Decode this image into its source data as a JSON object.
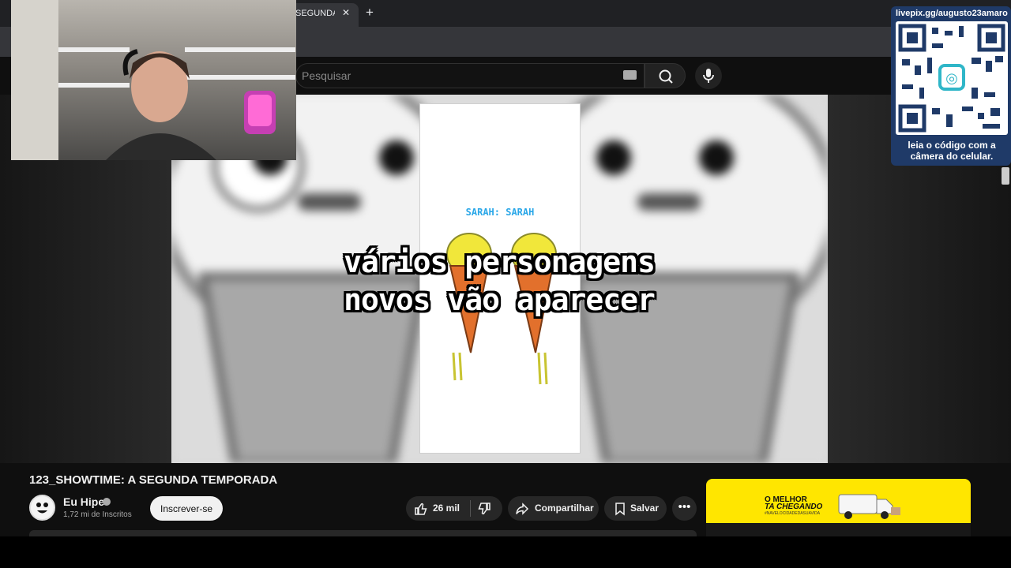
{
  "browser": {
    "tab_title": "SEGUNDA T",
    "tab_close": "✕",
    "new_tab": "+"
  },
  "search": {
    "placeholder": "Pesquisar"
  },
  "video": {
    "inner_caption": "SARAH: SARAH",
    "subtitle_line1": "vários personagens",
    "subtitle_line2": "novos vão aparecer",
    "title": "123_SHOWTIME: A SEGUNDA TEMPORADA"
  },
  "channel": {
    "name": "Eu Hipe",
    "subscribers": "1,72 mi de Inscritos",
    "subscribe_label": "Inscrever-se"
  },
  "actions": {
    "like_count": "26 mil",
    "share_label": "Compartilhar",
    "save_label": "Salvar",
    "more": "•••"
  },
  "qr": {
    "url": "livepix.gg/augusto23amaro",
    "caption": "leia o código com a câmera do celular."
  },
  "ad": {
    "line1": "O MELHOR",
    "line2": "TA CHEGANDO",
    "line3": "#NAVELOCIDADEDASUAVIDA",
    "brand_color": "#ffe600"
  }
}
